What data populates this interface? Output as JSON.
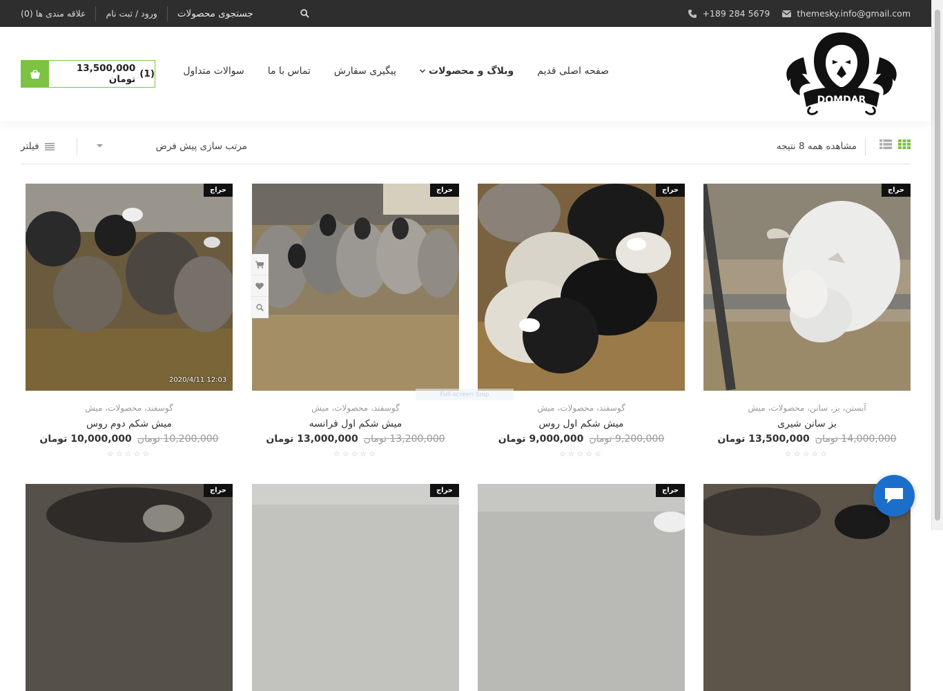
{
  "topbar": {
    "email": "themesky.info@gmail.com",
    "phone": "+189 284 5679",
    "wishlist": "علاقه مندی ها (0)",
    "login": "ورود / ثبت نام",
    "search": "جستجوی محصولات"
  },
  "logo": {
    "text": "DOMDAR"
  },
  "nav": {
    "items": [
      "صفحه اصلی قدیم",
      "وبلاگ و محصولات",
      "پیگیری سفارش",
      "تماس با ما",
      "سوالات متداول"
    ]
  },
  "cart": {
    "count": "(1)",
    "total": "13,500,000 تومان"
  },
  "toolbar": {
    "result_count": "مشاهده همه 8 نتیجه",
    "sort": "مرتب سازی پیش فرض",
    "filter": "فیلتر"
  },
  "sale_label": "حراج",
  "products": [
    {
      "cats": "آبستن، بز، سانن، محصولات، میش",
      "name": "بز سانن شیری",
      "price": "13,500,000 تومان",
      "old": "14,000,000 تومان"
    },
    {
      "cats": "گوسفند، محصولات، میش",
      "name": "میش شکم اول روس",
      "price": "9,000,000 تومان",
      "old": "9,200,000 تومان"
    },
    {
      "cats": "گوسفند، محصولات، میش",
      "name": "میش شکم اول فرانسه",
      "price": "13,000,000 تومان",
      "old": "13,200,000 تومان"
    },
    {
      "cats": "گوسفند، محصولات، میش",
      "name": "میش شکم دوم روس",
      "price": "10,000,000 تومان",
      "old": "10,200,000 تومان",
      "stamp": "2020/4/11  12:03"
    }
  ],
  "overlay": "Full-screen Snip",
  "colors": {
    "accent": "#7cc243",
    "topbar": "#2e2e2e",
    "chat": "#1b6fcb"
  },
  "icons": [
    "envelope-icon",
    "phone-icon",
    "search-icon",
    "bag-icon",
    "grid-icon",
    "list-icon",
    "filter-icon",
    "cart-icon",
    "heart-icon",
    "chat-icon"
  ]
}
